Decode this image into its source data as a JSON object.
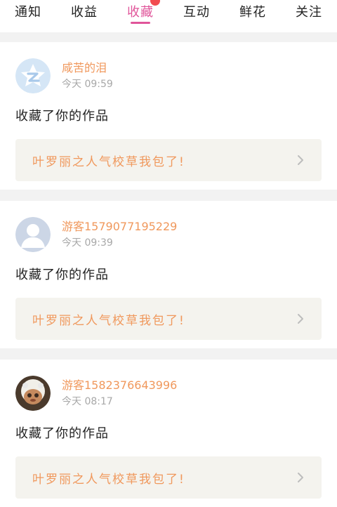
{
  "tabs": [
    {
      "label": "通知",
      "active": false
    },
    {
      "label": "收益",
      "active": false
    },
    {
      "label": "收藏",
      "active": true,
      "badge": true
    },
    {
      "label": "互动",
      "active": false
    },
    {
      "label": "鲜花",
      "active": false
    },
    {
      "label": "关注",
      "active": false
    }
  ],
  "notifications": [
    {
      "user": "咸苦的泪",
      "time": "今天 09:59",
      "action": "收藏了你的作品",
      "work_title": "叶罗丽之人气校草我包了!",
      "avatar_icon": "qzone-logo-avatar"
    },
    {
      "user": "游客1579077195229",
      "time": "今天 09:39",
      "action": "收藏了你的作品",
      "work_title": "叶罗丽之人气校草我包了!",
      "avatar_icon": "default-person-avatar"
    },
    {
      "user": "游客1582376643996",
      "time": "今天 08:17",
      "action": "收藏了你的作品",
      "work_title": "叶罗丽之人气校草我包了!",
      "avatar_icon": "photo-avatar"
    }
  ],
  "colors": {
    "accent_pink": "#e0559a",
    "username_orange": "#f0985c",
    "badge_red": "#f24b50",
    "card_link_bg": "#f4f3ee"
  }
}
